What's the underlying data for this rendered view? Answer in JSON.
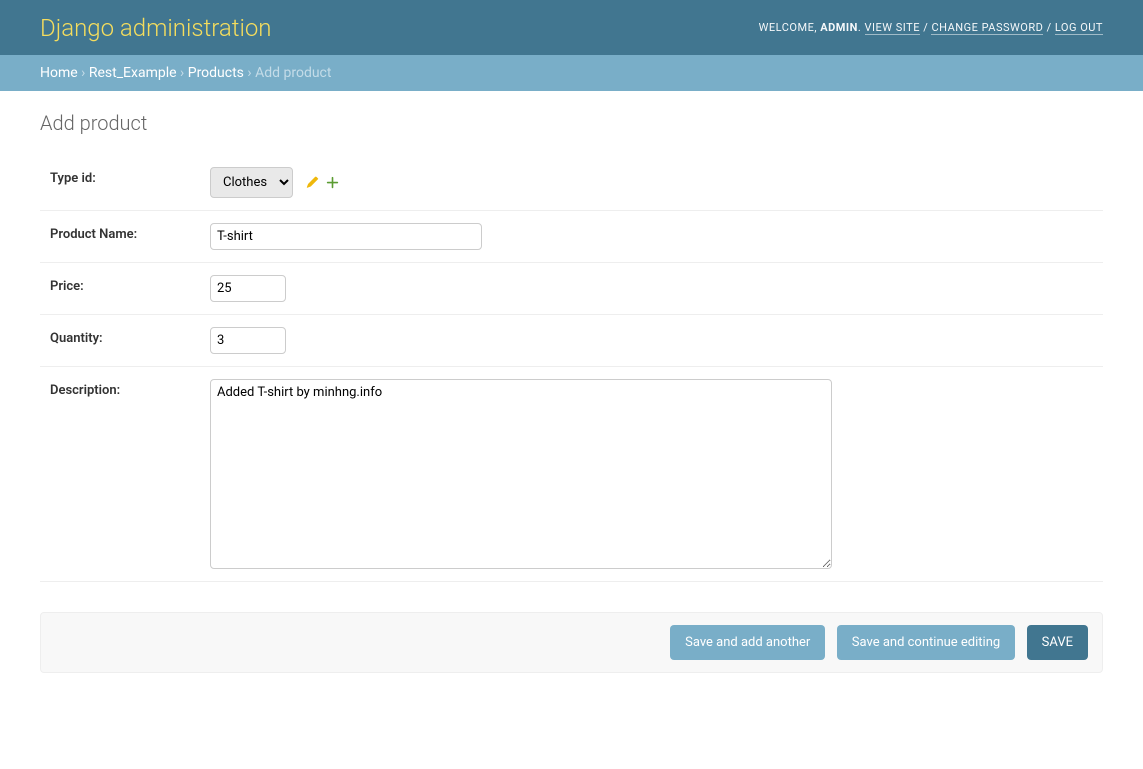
{
  "header": {
    "branding": "Django administration",
    "welcome": "WELCOME,",
    "user": "ADMIN",
    "view_site": "VIEW SITE",
    "change_password": "CHANGE PASSWORD",
    "logout": "LOG OUT",
    "sep": "/"
  },
  "breadcrumbs": {
    "home": "Home",
    "app": "Rest_Example",
    "model": "Products",
    "current": "Add product",
    "sep": "›"
  },
  "page": {
    "title": "Add product"
  },
  "form": {
    "type_id": {
      "label": "Type id:",
      "value": "Clothes"
    },
    "product_name": {
      "label": "Product Name:",
      "value": "T-shirt"
    },
    "price": {
      "label": "Price:",
      "value": "25"
    },
    "quantity": {
      "label": "Quantity:",
      "value": "3"
    },
    "description": {
      "label": "Description:",
      "value": "Added T-shirt by minhng.info"
    }
  },
  "submit": {
    "save_add_another": "Save and add another",
    "save_continue": "Save and continue editing",
    "save": "SAVE"
  }
}
